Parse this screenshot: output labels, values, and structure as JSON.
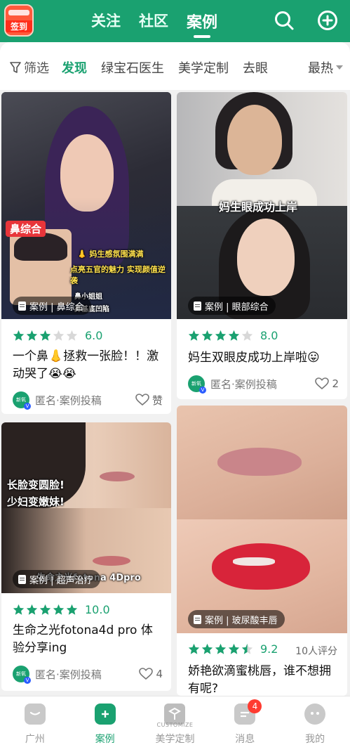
{
  "header": {
    "checkin_label": "签到",
    "tabs": [
      {
        "label": "关注",
        "active": false
      },
      {
        "label": "社区",
        "active": false
      },
      {
        "label": "案例",
        "active": true
      }
    ],
    "search_icon": "search-icon",
    "add_icon": "plus-circle-icon",
    "color": "#1aa170"
  },
  "filters": {
    "filter_label": "筛选",
    "chips": [
      "发现",
      "绿宝石医生",
      "美学定制",
      "去眼"
    ],
    "active_chip": "发现",
    "sort_label": "最热"
  },
  "cards": [
    {
      "overlay_texts": [
        "鼻综合",
        "👃 妈生感氛围满满",
        "点亮五官的魅力 实现颜值逆袭",
        "鼻小姐姐",
        "鼻基底凹陷"
      ],
      "tag": "案例 | 鼻综合",
      "rating": 3,
      "score": "6.0",
      "title": "一个鼻👃拯救一张脸！！激动哭了😭😭",
      "avatar_text": "新氧",
      "author": "匿名·案例投稿",
      "like_label": "赞"
    },
    {
      "overlay_texts": [
        "妈生眼成功上岸"
      ],
      "tag": "案例 | 眼部综合",
      "rating": 4,
      "score": "8.0",
      "title": "妈生双眼皮成功上岸啦😛",
      "avatar_text": "新氧",
      "author": "匿名·案例投稿",
      "like_label": "2"
    },
    {
      "overlay_texts": [
        "长脸变圆脸!",
        "少妇变嫩妹!",
        "生命之光fotona 4Dpro"
      ],
      "tag": "案例 | 超声治疗",
      "rating": 5,
      "score": "10.0",
      "title": "生命之光fotona4d pro 体验分享ing",
      "avatar_text": "新氧",
      "author": "匿名·案例投稿",
      "like_label": "4"
    },
    {
      "overlay_texts": [],
      "tag": "案例 | 玻尿酸丰唇",
      "rating": 4.5,
      "score": "9.2",
      "reviews": "10人评分",
      "title": "娇艳欲滴蜜桃唇，谁不想拥有呢?"
    }
  ],
  "bottom_nav": {
    "items": [
      {
        "label": "广州",
        "icon": "city-icon",
        "active": false
      },
      {
        "label": "案例",
        "icon": "folder-plus-icon",
        "active": true
      },
      {
        "label": "美学定制",
        "icon": "cube-icon",
        "active": false,
        "sublabel": "CUSTOMIZE"
      },
      {
        "label": "消息",
        "icon": "message-icon",
        "active": false,
        "badge": "4"
      },
      {
        "label": "我的",
        "icon": "profile-icon",
        "active": false
      }
    ]
  }
}
